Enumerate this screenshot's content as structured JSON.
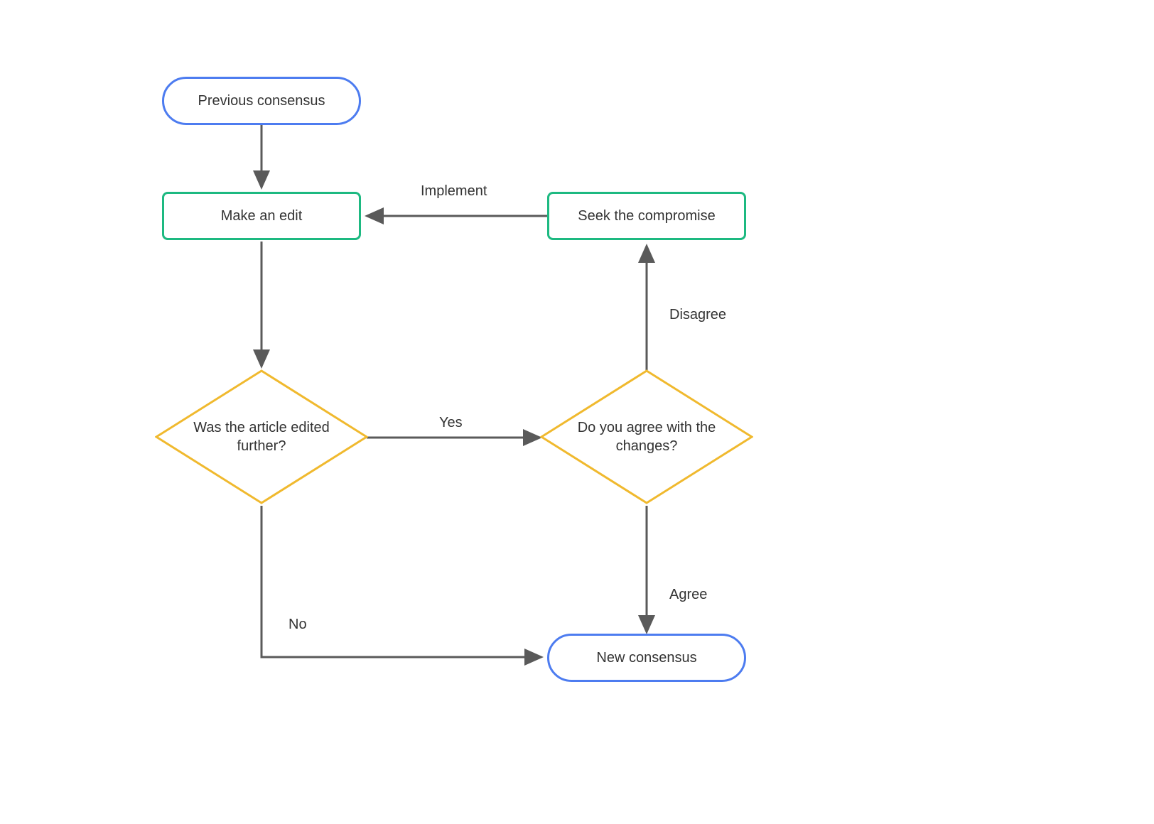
{
  "nodes": {
    "start": {
      "label": "Previous consensus"
    },
    "make_edit": {
      "label": "Make an edit"
    },
    "seek_compromise": {
      "label": "Seek the compromise"
    },
    "edited_further": {
      "label": "Was the article edited further?"
    },
    "agree_changes": {
      "label": "Do you agree with the changes?"
    },
    "end": {
      "label": "New consensus"
    }
  },
  "edges": {
    "implement": "Implement",
    "yes": "Yes",
    "no": "No",
    "disagree": "Disagree",
    "agree": "Agree"
  },
  "colors": {
    "terminator": "#4d7cf0",
    "process": "#1db981",
    "decision": "#f0b92e",
    "arrow": "#5a5a5a"
  }
}
